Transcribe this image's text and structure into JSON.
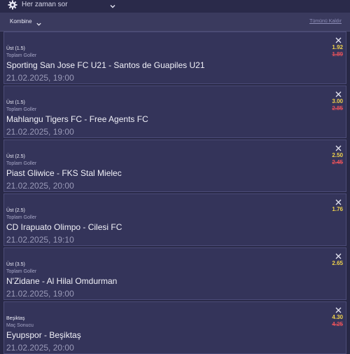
{
  "header": {
    "title": "Her zaman sor",
    "gear_icon": "gear-icon",
    "chevron_icon": "chevron-down-icon"
  },
  "subbar": {
    "mode_label": "Kombine",
    "clear_all_label": "Tümünü Kaldır"
  },
  "bets": [
    {
      "pick": "Üst (1.5)",
      "market": "Toplam Goller",
      "match": "Sporting San Jose FC U21 - Santos de Guapiles U21",
      "date": "21.02.2025, 19:00",
      "odd": "1.92",
      "old_odd": "1.89"
    },
    {
      "pick": "Üst (1.5)",
      "market": "Toplam Goller",
      "match": "Mahlangu Tigers FC - Free Agents FC",
      "date": "21.02.2025, 19:00",
      "odd": "3.00",
      "old_odd": "2.85"
    },
    {
      "pick": "Üst (2.5)",
      "market": "Toplam Goller",
      "match": "Piast Gliwice - FKS Stal Mielec",
      "date": "21.02.2025, 20:00",
      "odd": "2.50",
      "old_odd": "2.45"
    },
    {
      "pick": "Üst (2.5)",
      "market": "Toplam Goller",
      "match": "CD Irapuato Olimpo - Cilesi FC",
      "date": "21.02.2025, 19:10",
      "odd": "1.76",
      "old_odd": ""
    },
    {
      "pick": "Üst (3.5)",
      "market": "Toplam Goller",
      "match": "N'Zidane - Al Hilal Omdurman",
      "date": "21.02.2025, 19:00",
      "odd": "2.65",
      "old_odd": ""
    },
    {
      "pick": "Beşiktaş",
      "market": "Maç Sonucu",
      "match": "Eyupspor - Beşiktaş",
      "date": "21.02.2025, 20:00",
      "odd": "4.30",
      "old_odd": "4.25"
    }
  ],
  "colors": {
    "background": "#282846",
    "card": "#34345a",
    "odd": "#f0d34b",
    "old_odd": "#e0515a"
  }
}
